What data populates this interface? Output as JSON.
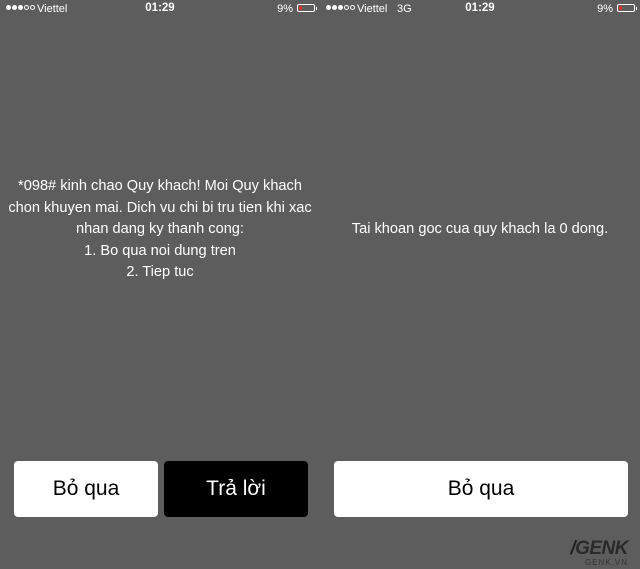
{
  "left": {
    "status": {
      "carrier": "Viettel",
      "network": "",
      "time": "01:29",
      "battery_percent": "9%",
      "battery_level": 0.09
    },
    "message_lines": [
      "*098# kinh chao Quy khach! Moi Quy khach",
      "chon khuyen mai. Dich vu chi bi tru tien khi xac",
      "nhan dang ky thanh cong:",
      "1. Bo qua noi dung tren",
      "2. Tiep tuc"
    ],
    "buttons": {
      "dismiss": "Bỏ qua",
      "reply": "Trả lời"
    }
  },
  "right": {
    "status": {
      "carrier": "Viettel",
      "network": "3G",
      "time": "01:29",
      "battery_percent": "9%",
      "battery_level": 0.09
    },
    "message": "Tai khoan goc cua quy khach la 0 dong.",
    "buttons": {
      "dismiss": "Bỏ qua"
    }
  },
  "watermark": {
    "logo": "GENK",
    "site": "GENK.VN"
  },
  "colors": {
    "background": "#5d5d5d",
    "button_white": "#ffffff",
    "button_black": "#000000",
    "battery_low": "#e0302a"
  }
}
